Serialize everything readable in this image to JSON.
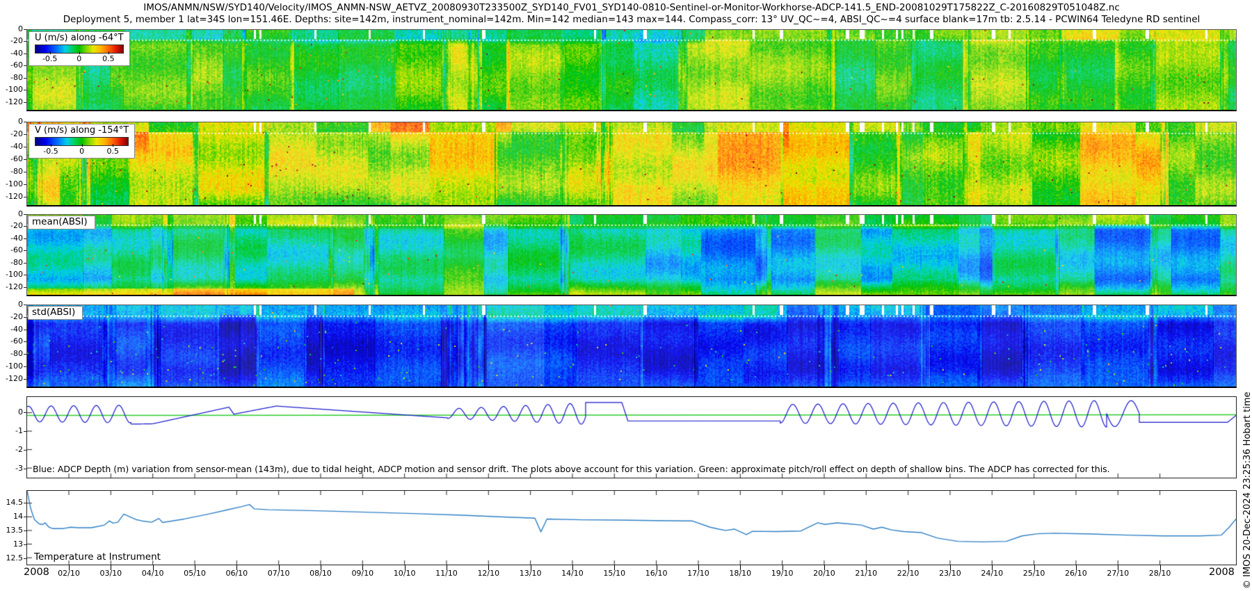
{
  "titles": {
    "line1": "IMOS/ANMN/NSW/SYD140/Velocity/IMOS_ANMN-NSW_AETVZ_20080930T233500Z_SYD140_FV01_SYD140-0810-Sentinel-or-Monitor-Workhorse-ADCP-141.5_END-20081029T175822Z_C-20160829T051048Z.nc",
    "line2": "Deployment 5, member 1 lat=34S lon=151.46E. Depths: site=142m, instrument_nominal=142m. Min=142 median=143 max=144. Compass_corr: 13° UV_QC~=4, ABSI_QC~=4 surface blank=17m tb: 2.5.14 - PCWIN64 Teledyne RD sentinel"
  },
  "watermark": "© IMOS 20-Dec-2024 23:25:36 Hobart time",
  "colors": {
    "jet_stops": [
      [
        0.0,
        "#000080"
      ],
      [
        0.11,
        "#0000f0"
      ],
      [
        0.25,
        "#0078ff"
      ],
      [
        0.34,
        "#00d0e8"
      ],
      [
        0.42,
        "#00d060"
      ],
      [
        0.5,
        "#00c000"
      ],
      [
        0.58,
        "#7fd800"
      ],
      [
        0.66,
        "#e8e800"
      ],
      [
        0.75,
        "#ffb000"
      ],
      [
        0.84,
        "#ff6000"
      ],
      [
        0.92,
        "#e01800"
      ],
      [
        1.0,
        "#800000"
      ]
    ],
    "blue_line": "#1515cc",
    "green_line": "#2ecc2e",
    "temp_line": "#2e7fc4",
    "axis": "#222222"
  },
  "xaxis": {
    "year_left": "2008",
    "year_right": "2008",
    "day_labels": [
      "02/10",
      "03/10",
      "04/10",
      "05/10",
      "06/10",
      "07/10",
      "08/10",
      "09/10",
      "10/10",
      "11/10",
      "12/10",
      "13/10",
      "14/10",
      "15/10",
      "16/10",
      "17/10",
      "18/10",
      "19/10",
      "20/10",
      "21/10",
      "22/10",
      "23/10",
      "24/10",
      "25/10",
      "26/10",
      "27/10",
      "28/10"
    ]
  },
  "chart_data": [
    {
      "id": "u_velocity",
      "type": "heatmap",
      "legend": {
        "title": "U (m/s) along -64°T",
        "ticks": [
          "-0.5",
          "0",
          "0.5"
        ],
        "range": [
          -0.7,
          0.7
        ]
      },
      "depth_axis": {
        "ticks": [
          {
            "l": "0",
            "frac": 0.0
          },
          {
            "l": "-20",
            "frac": 0.148
          },
          {
            "l": "-40",
            "frac": 0.296
          },
          {
            "l": "-60",
            "frac": 0.444
          },
          {
            "l": "-80",
            "frac": 0.593
          },
          {
            "l": "-100",
            "frac": 0.741
          },
          {
            "l": "-120",
            "frac": 0.889
          }
        ],
        "range_m": [
          0,
          -135
        ]
      },
      "blank_frac": 0.126,
      "texture": {
        "seed": 101,
        "fineProb": 0.55,
        "blockAmp": 0.1,
        "stripeAmp": 0.1,
        "cellAmp": 0.09,
        "bandFreq": 9,
        "bandAmp": 0.035,
        "speckle": 0.002,
        "topBlend": 0.18
      },
      "segments": [
        [
          0.0,
          0.3,
          0.52,
          0.42,
          0.5
        ],
        [
          0.3,
          0.44,
          0.55,
          0.4,
          0.52
        ],
        [
          0.44,
          0.56,
          0.5,
          0.38,
          0.5
        ],
        [
          0.56,
          0.75,
          0.53,
          0.54,
          0.52
        ],
        [
          0.75,
          1.0,
          0.54,
          0.6,
          0.54
        ]
      ]
    },
    {
      "id": "v_velocity",
      "type": "heatmap",
      "legend": {
        "title": "V (m/s) along -154°T",
        "ticks": [
          "-0.5",
          "0",
          "0.5"
        ],
        "range": [
          -0.7,
          0.7
        ]
      },
      "depth_axis": {
        "ticks": [
          {
            "l": "0",
            "frac": 0.0
          },
          {
            "l": "-20",
            "frac": 0.148
          },
          {
            "l": "-40",
            "frac": 0.296
          },
          {
            "l": "-60",
            "frac": 0.444
          },
          {
            "l": "-80",
            "frac": 0.593
          },
          {
            "l": "-100",
            "frac": 0.741
          },
          {
            "l": "-120",
            "frac": 0.889
          }
        ],
        "range_m": [
          0,
          -135
        ]
      },
      "blank_frac": 0.126,
      "texture": {
        "seed": 202,
        "fineProb": 0.5,
        "blockAmp": 0.11,
        "stripeAmp": 0.12,
        "cellAmp": 0.1,
        "bandFreq": 8,
        "bandAmp": 0.05,
        "speckle": 0.002,
        "topBlend": 0.4
      },
      "segments": [
        [
          0.0,
          0.1,
          0.58,
          0.74,
          0.52
        ],
        [
          0.1,
          0.3,
          0.58,
          0.6,
          0.5
        ],
        [
          0.3,
          0.4,
          0.62,
          0.7,
          0.56
        ],
        [
          0.4,
          0.56,
          0.62,
          0.58,
          0.58
        ],
        [
          0.56,
          0.63,
          0.64,
          0.72,
          0.6
        ],
        [
          0.63,
          0.8,
          0.6,
          0.56,
          0.56
        ],
        [
          0.8,
          1.0,
          0.62,
          0.6,
          0.58
        ]
      ]
    },
    {
      "id": "mean_absi",
      "type": "heatmap",
      "label": "mean(ABSI)",
      "depth_axis": {
        "ticks": [
          {
            "l": "0",
            "frac": 0.0
          },
          {
            "l": "-20",
            "frac": 0.148
          },
          {
            "l": "-40",
            "frac": 0.296
          },
          {
            "l": "-60",
            "frac": 0.444
          },
          {
            "l": "-80",
            "frac": 0.593
          },
          {
            "l": "-100",
            "frac": 0.741
          },
          {
            "l": "-120",
            "frac": 0.889
          }
        ],
        "range_m": [
          0,
          -135
        ]
      },
      "blank_frac": 0.126,
      "texture": {
        "seed": 303,
        "fineProb": 0.5,
        "blockAmp": 0.09,
        "stripeAmp": 0.08,
        "cellAmp": 0.07,
        "bandFreq": 10,
        "bandAmp": 0.05,
        "speckle": 0.0015,
        "topBlend": 0.18,
        "bottomBoost": {
          "fmax": 0.27,
          "dmin": 0.92,
          "amt": 0.14
        }
      },
      "segments": [
        [
          0.0,
          0.28,
          0.37,
          0.55,
          0.6
        ],
        [
          0.28,
          0.44,
          0.4,
          0.55,
          0.55
        ],
        [
          0.44,
          0.56,
          0.34,
          0.52,
          0.54
        ],
        [
          0.56,
          0.68,
          0.3,
          0.5,
          0.52
        ],
        [
          0.68,
          0.8,
          0.29,
          0.5,
          0.52
        ],
        [
          0.8,
          1.0,
          0.33,
          0.52,
          0.54
        ]
      ]
    },
    {
      "id": "std_absi",
      "type": "heatmap",
      "label": "std(ABSI)",
      "depth_axis": {
        "ticks": [
          {
            "l": "0",
            "frac": 0.0
          },
          {
            "l": "-20",
            "frac": 0.148
          },
          {
            "l": "-40",
            "frac": 0.296
          },
          {
            "l": "-60",
            "frac": 0.444
          },
          {
            "l": "-80",
            "frac": 0.593
          },
          {
            "l": "-100",
            "frac": 0.741
          },
          {
            "l": "-120",
            "frac": 0.889
          }
        ],
        "range_m": [
          0,
          -135
        ]
      },
      "blank_frac": 0.126,
      "texture": {
        "seed": 404,
        "fineProb": 0.65,
        "blockAmp": 0.06,
        "stripeAmp": 0.09,
        "cellAmp": 0.08,
        "bandFreq": 11,
        "bandAmp": 0.03,
        "speckle": 0.004,
        "topBlend": 0.22
      },
      "segments": [
        [
          0.0,
          0.3,
          0.12,
          0.3,
          0.2
        ],
        [
          0.3,
          0.45,
          0.14,
          0.32,
          0.18
        ],
        [
          0.45,
          0.62,
          0.11,
          0.34,
          0.18
        ],
        [
          0.62,
          0.8,
          0.13,
          0.27,
          0.18
        ],
        [
          0.8,
          1.0,
          0.12,
          0.3,
          0.2
        ]
      ]
    },
    {
      "id": "depth_variation",
      "type": "line",
      "caption": "Blue: ADCP Depth (m) variation from sensor-mean (143m), due to tidal height, ADCP motion and sensor drift. The plots above account for this variation. Green: approximate pitch/roll effect on depth of shallow bins. The ADCP has corrected for this.",
      "ylim": [
        0.85,
        -3.52
      ],
      "yticks": [
        {
          "l": "0",
          "v": 0,
          "frac": 0.1945
        },
        {
          "l": "-1",
          "v": -1,
          "frac": 0.4233
        },
        {
          "l": "-2",
          "v": -2,
          "frac": 0.6522
        },
        {
          "l": "-3",
          "v": -3,
          "frac": 0.881
        }
      ],
      "blue_segments": [
        {
          "t": "sin",
          "f0": 0.0,
          "f1": 0.086,
          "mean": -0.07,
          "a0": 0.42,
          "a1": 0.48,
          "cyc": 4.6,
          "ph": 1.2
        },
        {
          "t": "line",
          "f0": 0.086,
          "f1": 0.104,
          "v0": -0.62,
          "v1": -0.6
        },
        {
          "t": "line",
          "f0": 0.104,
          "f1": 0.167,
          "v0": -0.6,
          "v1": 0.3
        },
        {
          "t": "line",
          "f0": 0.167,
          "f1": 0.171,
          "v0": 0.3,
          "v1": -0.08
        },
        {
          "t": "line",
          "f0": 0.171,
          "f1": 0.206,
          "v0": -0.08,
          "v1": 0.36
        },
        {
          "t": "line",
          "f0": 0.206,
          "f1": 0.348,
          "v0": 0.36,
          "v1": -0.28
        },
        {
          "t": "sin",
          "f0": 0.348,
          "f1": 0.462,
          "mean": -0.05,
          "a0": 0.26,
          "a1": 0.58,
          "cyc": 6.2,
          "ph": -1.57
        },
        {
          "t": "line",
          "f0": 0.462,
          "f1": 0.492,
          "v0": 0.55,
          "v1": 0.55
        },
        {
          "t": "line",
          "f0": 0.492,
          "f1": 0.497,
          "v0": 0.55,
          "v1": -0.45
        },
        {
          "t": "line",
          "f0": 0.497,
          "f1": 0.623,
          "v0": -0.45,
          "v1": -0.45
        },
        {
          "t": "sin",
          "f0": 0.623,
          "f1": 0.893,
          "mean": -0.06,
          "a0": 0.5,
          "a1": 0.72,
          "cyc": 13,
          "ph": -1.57
        },
        {
          "t": "sin",
          "f0": 0.893,
          "f1": 0.92,
          "mean": -0.05,
          "a0": 0.7,
          "a1": 0.7,
          "cyc": 1,
          "ph": 3.14
        },
        {
          "t": "line",
          "f0": 0.92,
          "f1": 0.993,
          "v0": -0.52,
          "v1": -0.52
        },
        {
          "t": "line",
          "f0": 0.993,
          "f1": 1.0,
          "v0": -0.52,
          "v1": -0.15
        }
      ],
      "green_line": {
        "v0": -0.15,
        "v1": -0.11
      }
    },
    {
      "id": "temperature",
      "type": "line",
      "label": "Temperature at Instrument",
      "ylim": [
        14.95,
        12.25
      ],
      "yticks": [
        {
          "l": "14.5",
          "v": 14.5,
          "frac": 0.1667
        },
        {
          "l": "14",
          "v": 14,
          "frac": 0.3519
        },
        {
          "l": "13.5",
          "v": 13.5,
          "frac": 0.537
        },
        {
          "l": "13",
          "v": 13,
          "frac": 0.7222
        },
        {
          "l": "12.5",
          "v": 12.5,
          "frac": 0.9074
        }
      ],
      "points": [
        [
          0,
          14.95
        ],
        [
          0.003,
          14.3
        ],
        [
          0.006,
          13.9
        ],
        [
          0.01,
          13.74
        ],
        [
          0.013,
          13.72
        ],
        [
          0.015,
          13.78
        ],
        [
          0.018,
          13.62
        ],
        [
          0.021,
          13.57
        ],
        [
          0.03,
          13.57
        ],
        [
          0.036,
          13.62
        ],
        [
          0.042,
          13.6
        ],
        [
          0.053,
          13.6
        ],
        [
          0.059,
          13.65
        ],
        [
          0.064,
          13.7
        ],
        [
          0.068,
          13.85
        ],
        [
          0.071,
          13.77
        ],
        [
          0.075,
          13.8
        ],
        [
          0.08,
          14.1
        ],
        [
          0.086,
          13.98
        ],
        [
          0.09,
          13.9
        ],
        [
          0.095,
          13.85
        ],
        [
          0.103,
          13.8
        ],
        [
          0.109,
          13.94
        ],
        [
          0.112,
          13.79
        ],
        [
          0.13,
          13.92
        ],
        [
          0.15,
          14.1
        ],
        [
          0.165,
          14.25
        ],
        [
          0.178,
          14.38
        ],
        [
          0.184,
          14.45
        ],
        [
          0.188,
          14.29
        ],
        [
          0.2,
          14.26
        ],
        [
          0.24,
          14.22
        ],
        [
          0.28,
          14.17
        ],
        [
          0.32,
          14.12
        ],
        [
          0.36,
          14.06
        ],
        [
          0.39,
          14.0
        ],
        [
          0.42,
          13.95
        ],
        [
          0.425,
          13.45
        ],
        [
          0.43,
          13.92
        ],
        [
          0.46,
          13.89
        ],
        [
          0.49,
          13.88
        ],
        [
          0.52,
          13.86
        ],
        [
          0.55,
          13.85
        ],
        [
          0.565,
          13.62
        ],
        [
          0.572,
          13.55
        ],
        [
          0.578,
          13.5
        ],
        [
          0.585,
          13.55
        ],
        [
          0.595,
          13.35
        ],
        [
          0.6,
          13.47
        ],
        [
          0.62,
          13.46
        ],
        [
          0.64,
          13.48
        ],
        [
          0.654,
          13.78
        ],
        [
          0.66,
          13.72
        ],
        [
          0.67,
          13.78
        ],
        [
          0.68,
          13.74
        ],
        [
          0.69,
          13.7
        ],
        [
          0.7,
          13.55
        ],
        [
          0.707,
          13.62
        ],
        [
          0.715,
          13.52
        ],
        [
          0.725,
          13.46
        ],
        [
          0.74,
          13.42
        ],
        [
          0.753,
          13.22
        ],
        [
          0.77,
          13.1
        ],
        [
          0.79,
          13.08
        ],
        [
          0.81,
          13.1
        ],
        [
          0.823,
          13.3
        ],
        [
          0.836,
          13.38
        ],
        [
          0.85,
          13.4
        ],
        [
          0.88,
          13.37
        ],
        [
          0.91,
          13.33
        ],
        [
          0.94,
          13.3
        ],
        [
          0.97,
          13.3
        ],
        [
          0.988,
          13.33
        ],
        [
          0.994,
          13.6
        ],
        [
          1,
          13.92
        ]
      ]
    }
  ]
}
